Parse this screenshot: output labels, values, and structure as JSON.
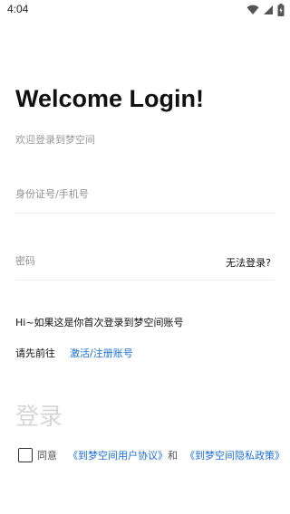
{
  "status_bar": {
    "time": "4:04",
    "icons": [
      "wifi-icon",
      "signal-icon",
      "battery-icon"
    ]
  },
  "header": {
    "title": "Welcome Login!",
    "subtitle": "欢迎登录到梦空间"
  },
  "form": {
    "id_placeholder": "身份证号/手机号",
    "id_value": "",
    "password_placeholder": "密码",
    "password_value": "",
    "forgot_label": "无法登录?"
  },
  "hints": {
    "first_time": "Hi~如果这是你首次登录到梦空间账号",
    "prefix": "请先前往",
    "activate": "激活",
    "slash": "/",
    "register": "注册账号"
  },
  "login_button": "登录",
  "agreement": {
    "checked": false,
    "agree_label": "同意",
    "terms": "《到梦空间用户协议》",
    "and": "和",
    "privacy": "《到梦空间隐私政策》"
  },
  "colors": {
    "link": "#1a6fd8",
    "button_disabled": "#d6d6d6",
    "placeholder": "#8f8f8f"
  }
}
